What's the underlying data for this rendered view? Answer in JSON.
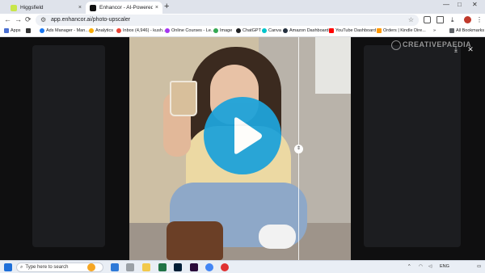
{
  "browser": {
    "tabs": [
      {
        "title": "Higgsfield",
        "favicon_color": "#c8e64a"
      },
      {
        "title": "Enhancor - AI-Powered Skin Te",
        "favicon_color": "#111111"
      }
    ],
    "new_tab_symbol": "+",
    "close_symbol": "×",
    "address": "app.enhancor.ai/photo-upscaler",
    "nav": {
      "back": "←",
      "forward": "→",
      "reload": "⟳"
    }
  },
  "bookmarks": [
    {
      "label": "Apps",
      "color": "#4a6fd1"
    },
    {
      "label": "Ads Manager - Man...",
      "color": "#1877f2"
    },
    {
      "label": "Analytics",
      "color": "#f9ab00"
    },
    {
      "label": "Inbox (4,946) - kush...",
      "color": "#ea4335"
    },
    {
      "label": "Online Courses - Le...",
      "color": "#a435f0"
    },
    {
      "label": "Image",
      "color": "#34a853"
    },
    {
      "label": "ChatGPT",
      "color": "#202124"
    },
    {
      "label": "Canva",
      "color": "#00c4cc"
    },
    {
      "label": "Amazon Dashboard",
      "color": "#232f3e"
    },
    {
      "label": "YouTube Dashboard",
      "color": "#ff0000"
    },
    {
      "label": "Orders | Kindle Dire...",
      "color": "#f90"
    },
    {
      "label": "All Bookmarks",
      "color": "#5f6368"
    }
  ],
  "viewer": {
    "download_icon": "⤓",
    "close_icon": "✕",
    "compare_handle": "⇕",
    "play_color": "#1fa3d9"
  },
  "watermark": "CREATIVEPAEDIA",
  "taskbar": {
    "search_placeholder": "Type here to search",
    "lang": "ENG",
    "apps": [
      "#f5a623",
      "#2f7ad8",
      "#1f1f1f",
      "#217346",
      "#001e36",
      "#001e36",
      "#4285f4",
      "#e03131"
    ]
  }
}
